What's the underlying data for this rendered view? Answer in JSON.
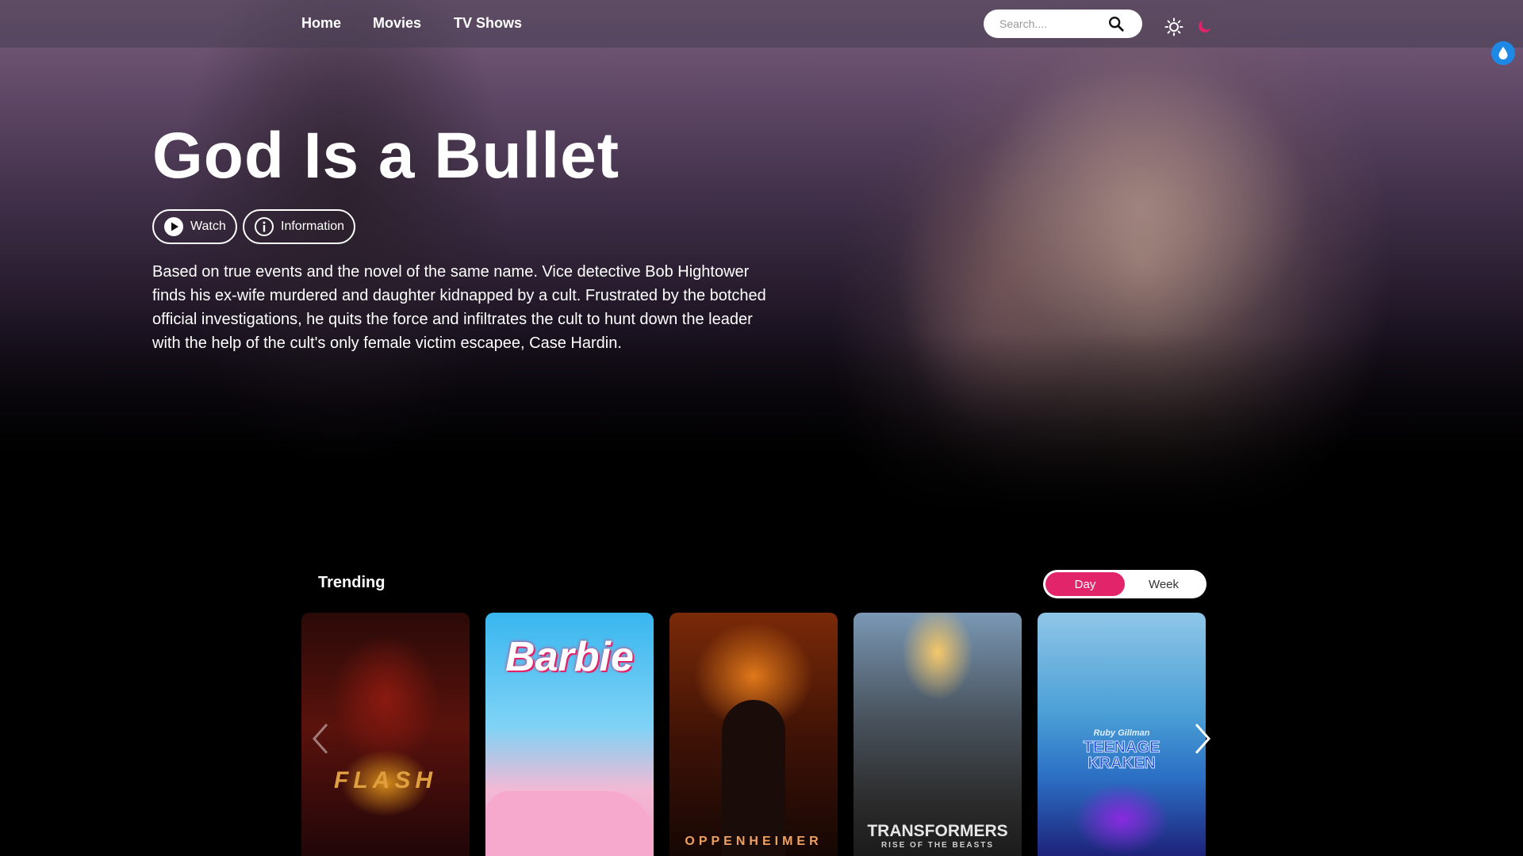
{
  "nav": {
    "links": [
      "Home",
      "Movies",
      "TV Shows"
    ],
    "search_placeholder": "Search....",
    "icons": [
      "search-icon",
      "sun-icon",
      "moon-icon",
      "water-drop-icon"
    ],
    "accent": "#e2246a"
  },
  "hero": {
    "title": "God Is a Bullet",
    "watch_label": "Watch",
    "info_label": "Information",
    "description": "Based on true events and the novel of the same name. Vice detective Bob Hightower finds his ex-wife murdered and daughter kidnapped by a cult. Frustrated by the botched official investigations, he quits the force and infiltrates the cult to hunt down the leader with the help of the cult's only female victim escapee, Case Hardin."
  },
  "trending": {
    "title": "Trending",
    "toggle": {
      "day": "Day",
      "week": "Week",
      "selected": "Day"
    },
    "posters": [
      {
        "title": "FLASH"
      },
      {
        "title": "Barbie"
      },
      {
        "title": "OPPENHEIMER"
      },
      {
        "title": "TRANSFORMERS",
        "subtitle": "RISE OF THE BEASTS"
      },
      {
        "title": "TEENAGE KRAKEN",
        "subtitle": "Ruby Gillman"
      }
    ]
  }
}
